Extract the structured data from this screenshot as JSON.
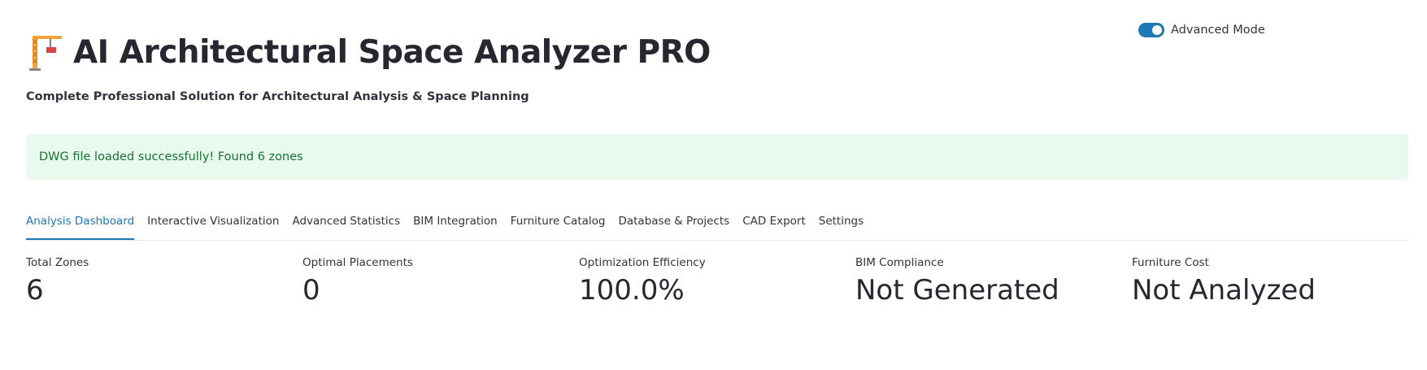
{
  "header": {
    "title": "AI Architectural Space Analyzer PRO",
    "subtitle": "Complete Professional Solution for Architectural Analysis & Space Planning",
    "icon": "crane-icon"
  },
  "advanced_mode": {
    "label": "Advanced Mode",
    "enabled": true
  },
  "alert": {
    "text": "DWG file loaded successfully! Found 6 zones",
    "color": "#177233",
    "background": "#e8f9ee"
  },
  "tabs": [
    {
      "label": "Analysis Dashboard",
      "active": true
    },
    {
      "label": "Interactive Visualization",
      "active": false
    },
    {
      "label": "Advanced Statistics",
      "active": false
    },
    {
      "label": "BIM Integration",
      "active": false
    },
    {
      "label": "Furniture Catalog",
      "active": false
    },
    {
      "label": "Database & Projects",
      "active": false
    },
    {
      "label": "CAD Export",
      "active": false
    },
    {
      "label": "Settings",
      "active": false
    }
  ],
  "metrics": [
    {
      "label": "Total Zones",
      "value": "6"
    },
    {
      "label": "Optimal Placements",
      "value": "0"
    },
    {
      "label": "Optimization Efficiency",
      "value": "100.0%"
    },
    {
      "label": "BIM Compliance",
      "value": "Not Generated"
    },
    {
      "label": "Furniture Cost",
      "value": "Not Analyzed"
    }
  ],
  "colors": {
    "accent": "#1f77b4",
    "text": "#31333f"
  }
}
